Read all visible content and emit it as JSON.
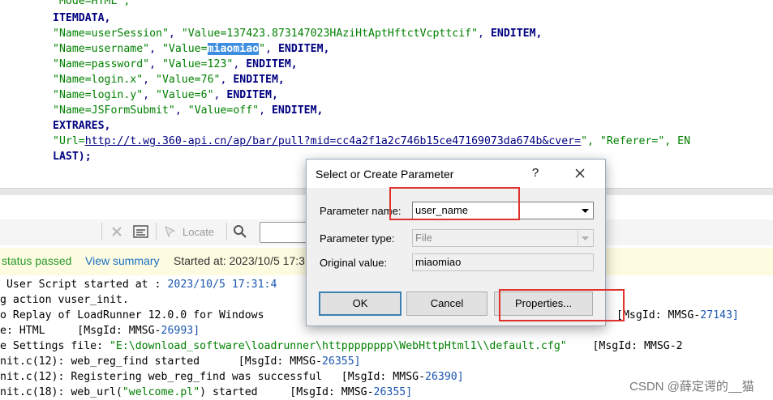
{
  "editor": {
    "line0_partial": "\"Mode=HTML\",",
    "line1": "ITEMDATA,",
    "line2": {
      "name": "\"Name=userSession\"",
      "value": "\"Value=137423.873147023HAziHtAptHftctVcpttcif\"",
      "end": "ENDITEM,"
    },
    "line3": {
      "name": "\"Name=username\"",
      "value_prefix": "\"Value=",
      "value_highlight": "miaomiao",
      "value_suffix": "\"",
      "end": "ENDITEM,"
    },
    "line4": {
      "name": "\"Name=password\"",
      "value": "\"Value=123\"",
      "end": "ENDITEM,"
    },
    "line5": {
      "name": "\"Name=login.x\"",
      "value": "\"Value=76\"",
      "end": "ENDITEM,"
    },
    "line6": {
      "name": "\"Name=login.y\"",
      "value": "\"Value=6\"",
      "end": "ENDITEM,"
    },
    "line7": {
      "name": "\"Name=JSFormSubmit\"",
      "value": "\"Value=off\"",
      "end": "ENDITEM,"
    },
    "line8": "EXTRARES,",
    "line9": {
      "prefix": "\"Url=",
      "url": "http://t.wg.360-api.cn/ap/bar/pull?mid=cc4a2f1a2c746b15ce47169073da674b&cver=",
      "suffix": "\", \"Referer=\", EN"
    },
    "line10": "LAST);"
  },
  "toolbar": {
    "locate_label": "Locate"
  },
  "status": {
    "passed": "status passed",
    "view_summary": "View summary",
    "started": "Started at: 2023/10/5 17:3"
  },
  "log": {
    "l1a": " User Script started at : ",
    "l1b": "2023/10/5 17:31:4",
    "l2": "g action vuser_init.",
    "l3a": "o Replay of LoadRunner 12.0.0 for Windows",
    "l3b": "[MsgId: MMSG-",
    "l3c": "27143]",
    "l4a": "e: HTML     [MsgId: MMSG-",
    "l4b": "26993]",
    "l5a": "e Settings file: ",
    "l5b": "\"E:\\download_software\\loadrunner\\httpppppppp\\WebHttpHtml1\\\\default.cfg\"",
    "l5c": "    [MsgId: MMSG-2",
    "l6a": "nit.c(12): web_reg_find started      [MsgId: MMSG-",
    "l6b": "26355]",
    "l7a": "nit.c(12): Registering web_reg_find was successful   [MsgId: MMSG-",
    "l7b": "26390]",
    "l8a": "nit.c(18): web_url(",
    "l8b": "\"welcome.pl\"",
    "l8c": ") started     [MsgId: MMSG-",
    "l8d": "26355]"
  },
  "dialog": {
    "title": "Select or Create Parameter",
    "help": "?",
    "param_name_label": "Parameter name:",
    "param_name_value": "user_name",
    "param_type_label": "Parameter type:",
    "param_type_value": "File",
    "orig_value_label": "Original value:",
    "orig_value_value": "miaomiao",
    "ok": "OK",
    "cancel": "Cancel",
    "properties": "Properties..."
  },
  "watermark": "CSDN @薛定谔的__猫",
  "colors": {
    "highlight": "#3d8ee0",
    "annotation": "#e0322d",
    "string": "#008000",
    "keyword": "#000080"
  }
}
